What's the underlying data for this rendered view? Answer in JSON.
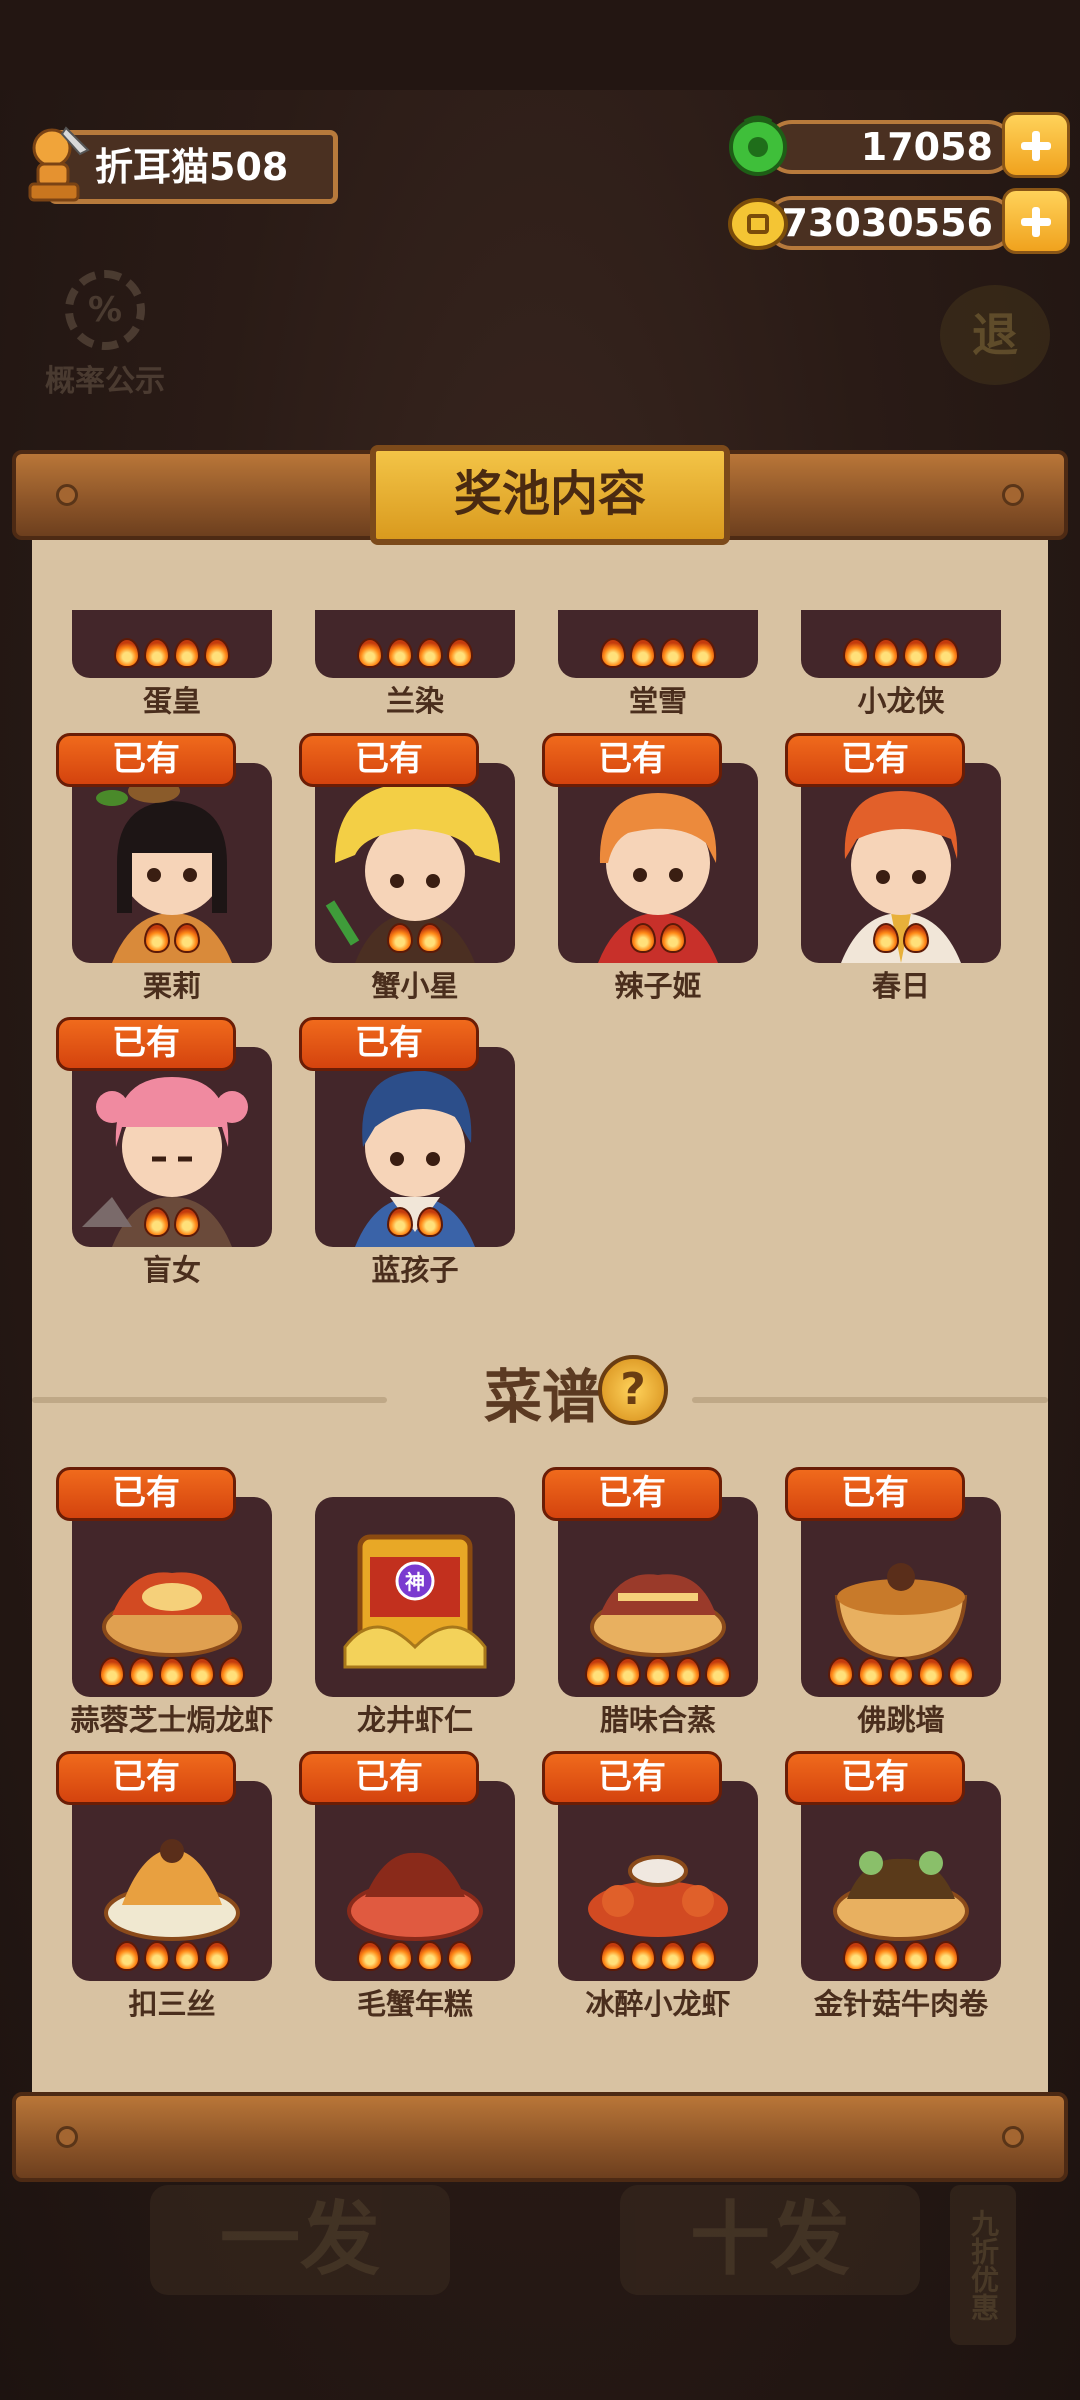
{
  "player": {
    "name": "折耳猫508"
  },
  "currency": [
    {
      "icon": "jade-coin-icon",
      "value": "17058"
    },
    {
      "icon": "gold-coin-icon",
      "value": "73030556"
    }
  ],
  "background": {
    "probability_label": "概率公示",
    "probability_icon_text": "%",
    "exit_label": "退",
    "single_draw_label": "一发",
    "ten_draw_label": "十发",
    "discount_tag": "九折优惠"
  },
  "panel": {
    "title": "奖池内容",
    "owned_badge": "已有",
    "characters": [
      {
        "name": "蛋皇",
        "owned": false,
        "stars": 4
      },
      {
        "name": "兰染",
        "owned": false,
        "stars": 4
      },
      {
        "name": "堂雪",
        "owned": false,
        "stars": 4
      },
      {
        "name": "小龙侠",
        "owned": false,
        "stars": 4
      },
      {
        "name": "栗莉",
        "owned": true,
        "stars": 2
      },
      {
        "name": "蟹小星",
        "owned": true,
        "stars": 2
      },
      {
        "name": "辣子姬",
        "owned": true,
        "stars": 2
      },
      {
        "name": "春日",
        "owned": true,
        "stars": 2
      },
      {
        "name": "盲女",
        "owned": true,
        "stars": 2
      },
      {
        "name": "蓝孩子",
        "owned": true,
        "stars": 2
      }
    ],
    "recipes_title": "菜谱",
    "recipes_help": "?",
    "recipes": [
      {
        "name": "蒜蓉芝士焗龙虾",
        "owned": true,
        "stars": 5
      },
      {
        "name": "龙井虾仁",
        "owned": false,
        "stars": 0,
        "badge": "神"
      },
      {
        "name": "腊味合蒸",
        "owned": true,
        "stars": 5
      },
      {
        "name": "佛跳墙",
        "owned": true,
        "stars": 5
      },
      {
        "name": "扣三丝",
        "owned": true,
        "stars": 4
      },
      {
        "name": "毛蟹年糕",
        "owned": true,
        "stars": 4
      },
      {
        "name": "冰醉小龙虾",
        "owned": true,
        "stars": 4
      },
      {
        "name": "金针菇牛肉卷",
        "owned": true,
        "stars": 4
      }
    ]
  }
}
